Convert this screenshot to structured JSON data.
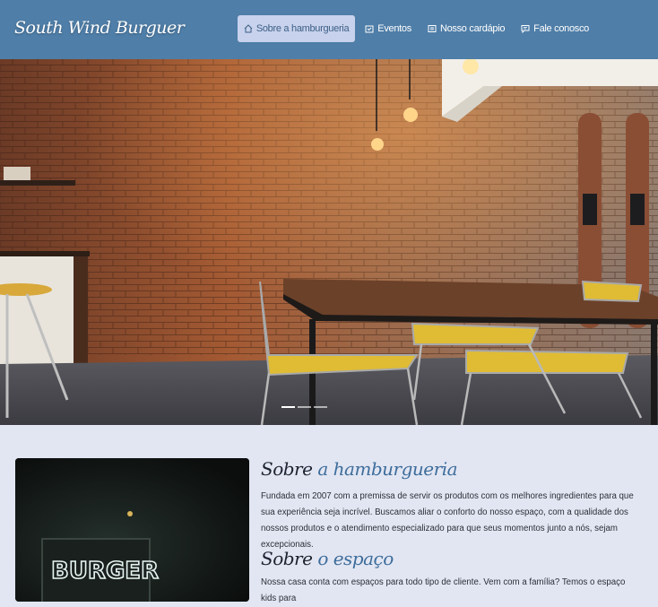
{
  "brand": "South Wind Burguer",
  "nav": [
    {
      "label": "Sobre a hamburgueria",
      "icon": "home-icon",
      "active": true
    },
    {
      "label": "Eventos",
      "icon": "calendar-icon"
    },
    {
      "label": "Nosso cardápio",
      "icon": "menu-book-icon"
    },
    {
      "label": "Fale conosco",
      "icon": "chat-icon"
    }
  ],
  "colors": {
    "navbar": "#4f7ea8",
    "page_bg": "#e2e6f2",
    "accent": "#3e6d9c",
    "active_nav": "#c8d2ec"
  },
  "carousel": {
    "slides": 3,
    "active": 1
  },
  "about": {
    "title_1": "Sobre",
    "title_1_accent": "a hamburgueria",
    "text_1": "Fundada em 2007 com a premissa de servir os produtos com os melhores ingredientes para que sua experiência seja incrível. Buscamos aliar o conforto do nosso espaço, com a qualidade dos nossos produtos e o atendimento especializado para que seus momentos junto a nós, sejam excepcionais.",
    "title_2": "Sobre",
    "title_2_accent": "o espaço",
    "text_2": "Nossa casa conta com espaços para todo tipo de cliente. Vem com a família? Temos o espaço kids para",
    "image_sign": "BURGER"
  }
}
